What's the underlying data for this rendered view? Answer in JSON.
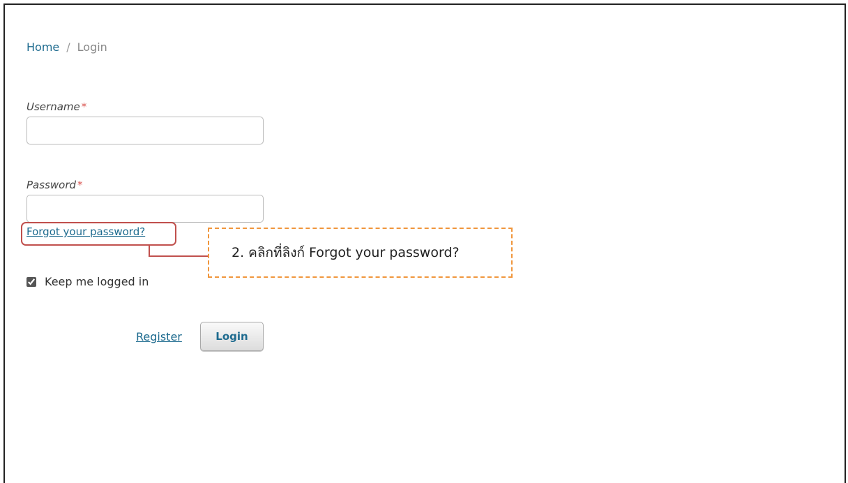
{
  "breadcrumb": {
    "home": "Home",
    "separator": "/",
    "current": "Login"
  },
  "form": {
    "username_label": "Username",
    "password_label": "Password",
    "required_mark": "*",
    "username_value": "",
    "password_value": "",
    "forgot_link": "Forgot your password?",
    "remember_label": "Keep me logged in",
    "remember_checked": true,
    "register_link": "Register",
    "login_button": "Login"
  },
  "annotation": {
    "callout_text": "2. คลิกที่ลิงก์ Forgot your password?",
    "highlight_color": "#c0504d",
    "callout_border_color": "#f0963c"
  },
  "colors": {
    "link": "#1e6b8f",
    "required": "#d9534f"
  }
}
